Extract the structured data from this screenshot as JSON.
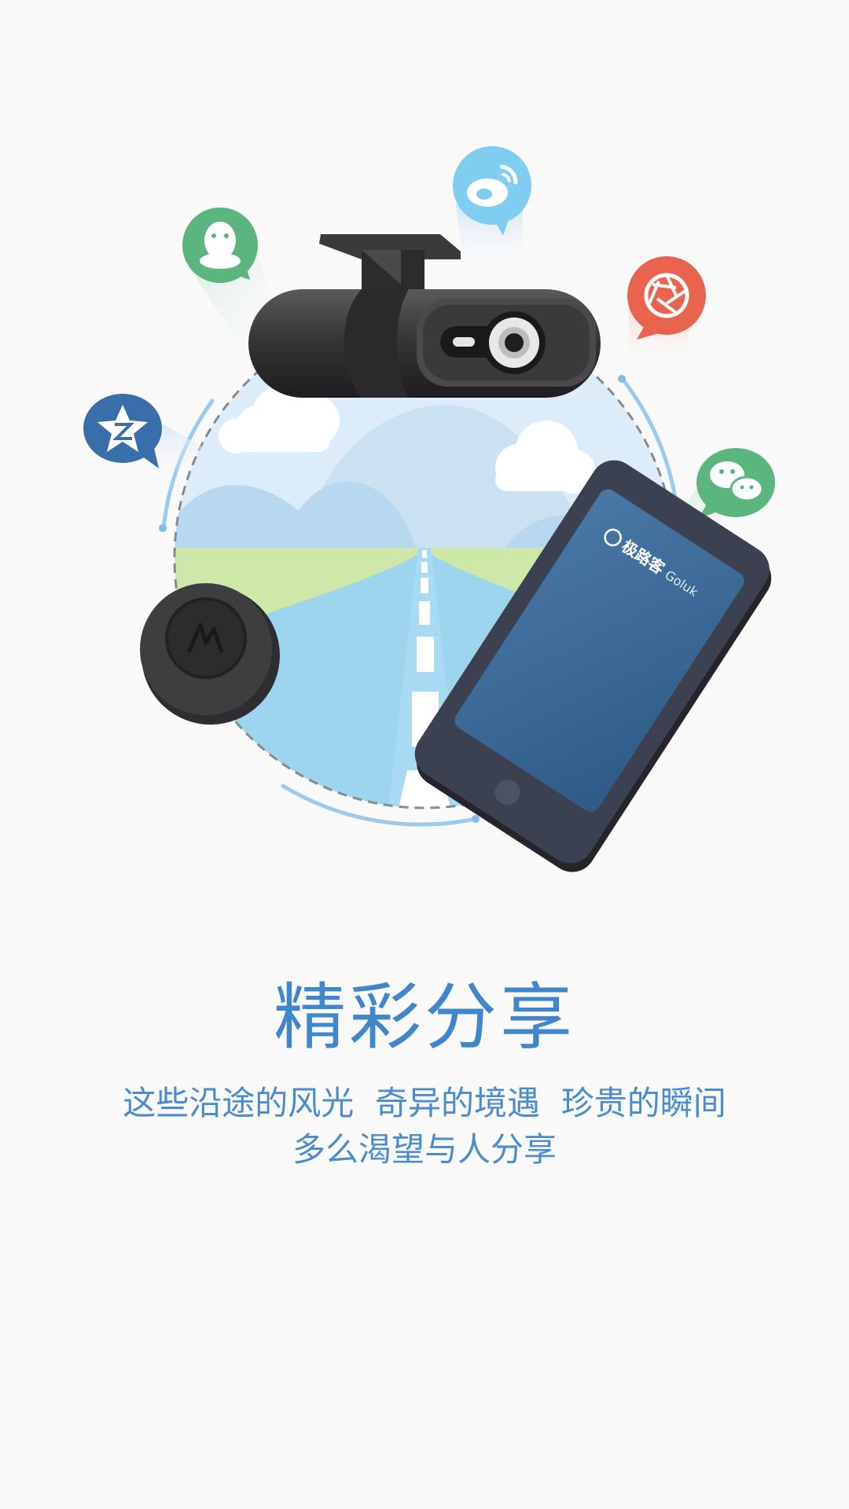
{
  "app": {
    "brand_name": "极路客",
    "brand_name_en": "Goluk"
  },
  "onboarding": {
    "title": "精彩分享",
    "subtitle_line1": "这些沿途的风光  奇异的境遇  珍贵的瞬间",
    "subtitle_line2": "多么渴望与人分享"
  },
  "share_icons": [
    {
      "name": "qq-icon",
      "color": "#5bb57f"
    },
    {
      "name": "weibo-icon",
      "color": "#7fcdf0"
    },
    {
      "name": "camera-shutter-icon",
      "color": "#e8644f"
    },
    {
      "name": "qzone-icon",
      "color": "#3a6eab"
    },
    {
      "name": "wechat-icon",
      "color": "#5bb57f"
    }
  ],
  "colors": {
    "accent": "#3f86cc",
    "background": "#f9f9fa",
    "sky": "#dcecf8",
    "grass": "#cde8a8",
    "road": "#9dd4ee",
    "device": "#3a3a3c"
  }
}
